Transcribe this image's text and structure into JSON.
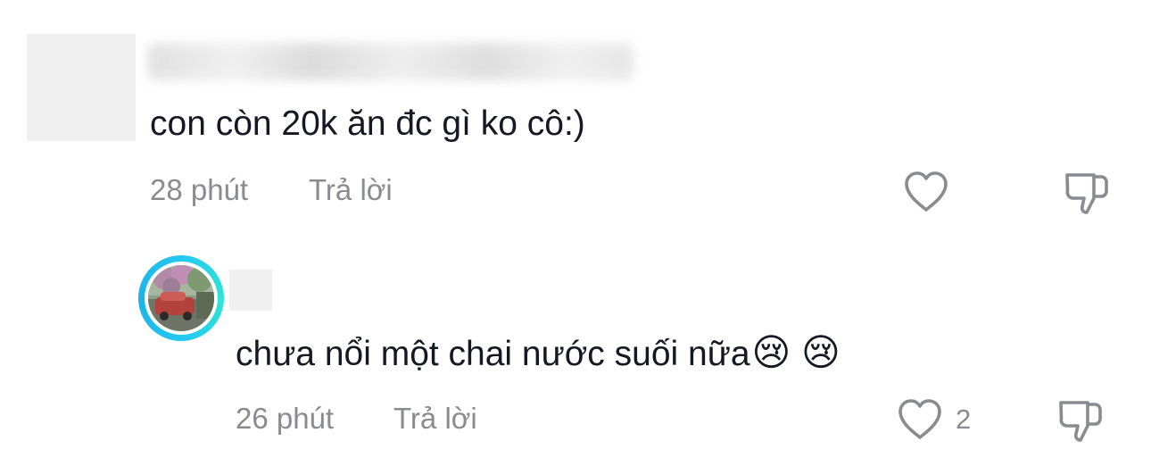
{
  "comments": [
    {
      "text": "con còn 20k ăn đc gì ko cô:)",
      "time": "28 phút",
      "reply_label": "Trả lời",
      "like_icon": "heart-outline-icon",
      "dislike_icon": "thumbs-down-outline-icon"
    },
    {
      "text": "chưa nổi một chai nước suối nữa",
      "emoji": "😢 😢",
      "time": "26 phút",
      "reply_label": "Trả lời",
      "like_count": "2",
      "like_icon": "heart-outline-icon",
      "dislike_icon": "thumbs-down-outline-icon",
      "avatar_ring_color": "#25c7f0"
    }
  ],
  "colors": {
    "text": "#161823",
    "meta": "#8a8b91",
    "placeholder": "#f0f0f0"
  }
}
